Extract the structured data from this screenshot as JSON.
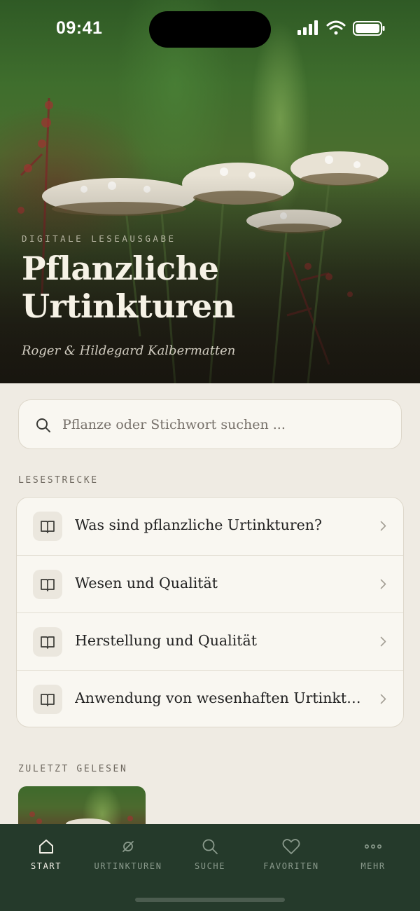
{
  "status_bar": {
    "time": "09:41"
  },
  "hero": {
    "kicker": "DIGITALE LESEAUSGABE",
    "title_line1": "Pflanzliche",
    "title_line2": "Urtinkturen",
    "authors": "Roger & Hildegard Kalbermatten"
  },
  "search": {
    "placeholder": "Pflanze oder Stichwort suchen ...",
    "value": "",
    "icon": "search-icon"
  },
  "reading_path": {
    "label": "LESESTRECKE",
    "items": [
      {
        "label": "Was sind pflanzliche Urtinkturen?",
        "icon": "book-icon"
      },
      {
        "label": "Wesen und Qualität",
        "icon": "book-icon"
      },
      {
        "label": "Herstellung und Qualität",
        "icon": "book-icon"
      },
      {
        "label": "Anwendung von wesenhaften Urtinkturen",
        "icon": "book-icon"
      }
    ]
  },
  "recent": {
    "label": "ZULETZT GELESEN"
  },
  "tabbar": {
    "tabs": [
      {
        "label": "START",
        "icon": "home-icon",
        "active": true
      },
      {
        "label": "URTINKTUREN",
        "icon": "empty-set-icon",
        "active": false
      },
      {
        "label": "SUCHE",
        "icon": "search-icon",
        "active": false
      },
      {
        "label": "FAVORITEN",
        "icon": "heart-icon",
        "active": false
      },
      {
        "label": "MEHR",
        "icon": "more-icon",
        "active": false
      }
    ]
  },
  "colors": {
    "background": "#efebe3",
    "card": "#f9f7f1",
    "tabbar": "#253a2b",
    "hero_title": "#f6f2e6"
  }
}
